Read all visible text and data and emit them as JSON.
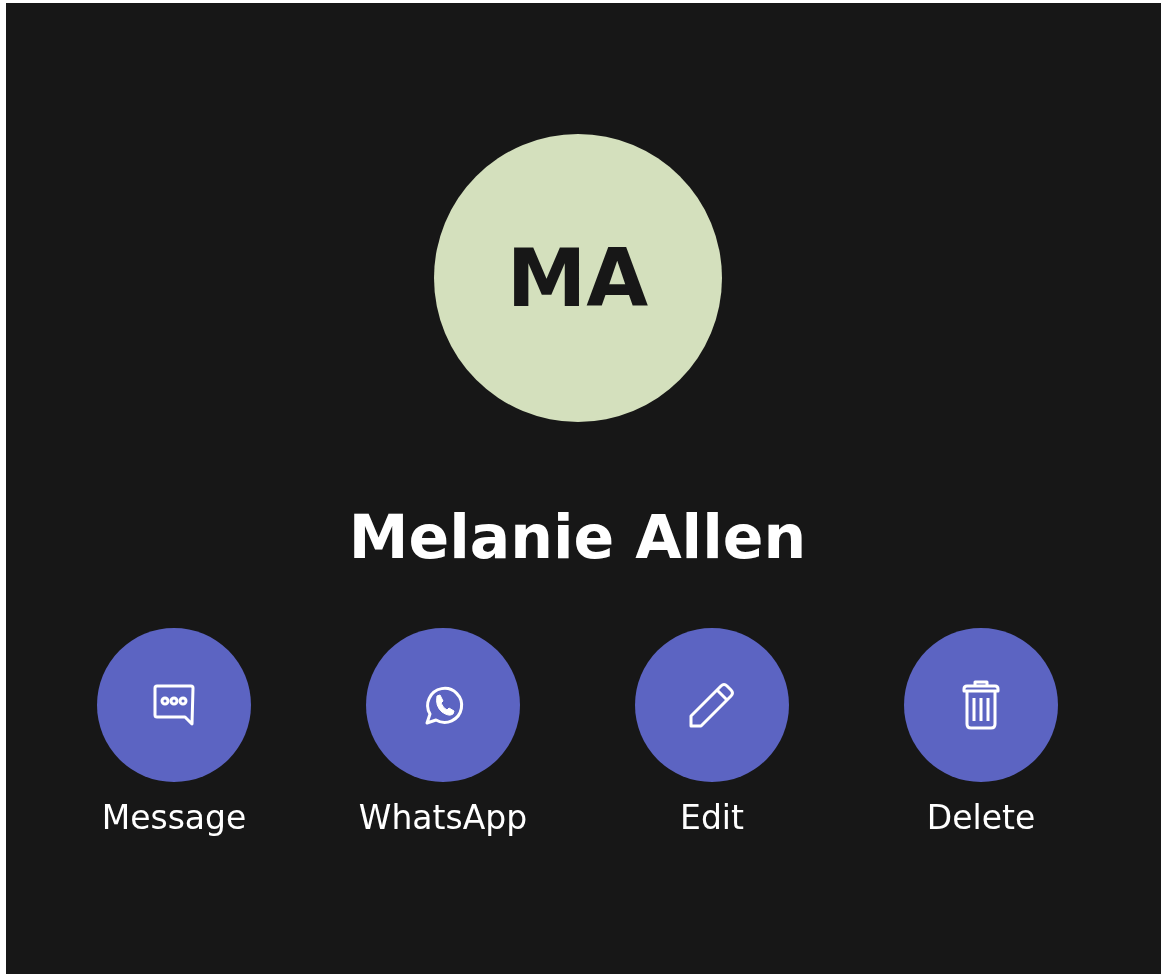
{
  "contact": {
    "initials": "MA",
    "name": "Melanie Allen"
  },
  "actions": [
    {
      "label": "Message",
      "kind": "message"
    },
    {
      "label": "WhatsApp",
      "kind": "whatsapp"
    },
    {
      "label": "Edit",
      "kind": "edit"
    },
    {
      "label": "Delete",
      "kind": "delete"
    }
  ]
}
